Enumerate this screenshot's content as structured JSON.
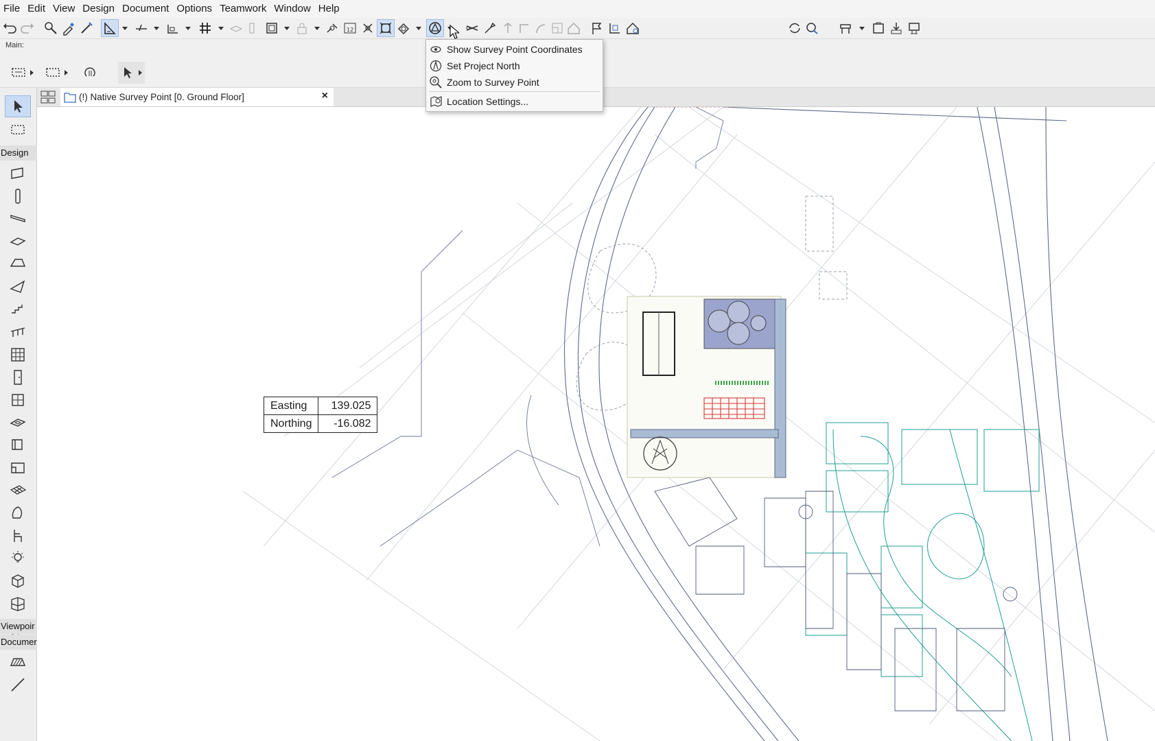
{
  "menu": [
    "File",
    "Edit",
    "View",
    "Design",
    "Document",
    "Options",
    "Teamwork",
    "Window",
    "Help"
  ],
  "main_toolbar": {
    "label": "Main:"
  },
  "toolbox": {
    "sections": {
      "design": "Design",
      "viewpoint": "Viewpoir",
      "document": "Documer"
    }
  },
  "tab": {
    "title": "(!) Native Survey Point [0. Ground Floor]",
    "close": "×"
  },
  "dropdown": {
    "items": [
      {
        "label": "Show Survey Point Coordinates",
        "icon": "survey-coordinates-icon"
      },
      {
        "label": "Set Project North",
        "icon": "project-north-icon"
      },
      {
        "label": "Zoom to Survey Point",
        "icon": "zoom-survey-icon"
      },
      {
        "label": "Location Settings...",
        "icon": "location-settings-icon"
      }
    ]
  },
  "coordinates": {
    "easting_label": "Easting",
    "easting_value": "139.025",
    "northing_label": "Northing",
    "northing_value": "-16.082"
  },
  "colors": {
    "plan_line": "#7f8aa3",
    "plan_teal": "#1f9c93",
    "plan_green": "#3aa648",
    "plan_red": "#d63a3a",
    "building_fill": "#9aa4cc",
    "road_fill": "#a9bcd4"
  }
}
